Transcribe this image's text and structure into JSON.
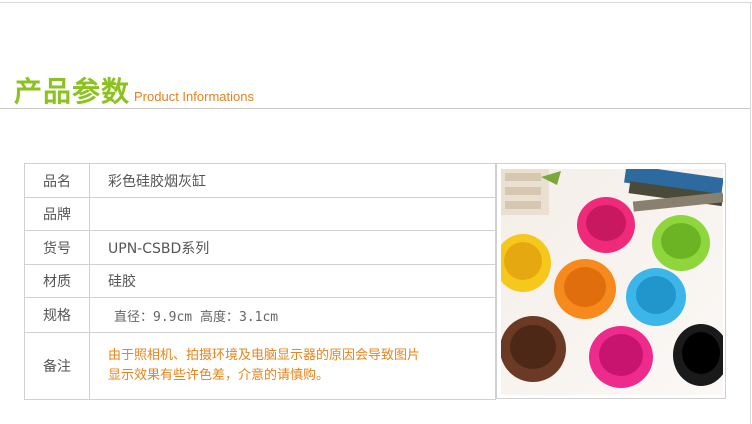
{
  "header": {
    "title_cn": "产品参数",
    "title_en": "Product Informations"
  },
  "specs": [
    {
      "label": "品名",
      "value": "彩色硅胶烟灰缸"
    },
    {
      "label": "品牌",
      "value": ""
    },
    {
      "label": "货号",
      "value": "UPN-CSBD系列"
    },
    {
      "label": "材质",
      "value": "硅胶"
    },
    {
      "label": "规格",
      "value": "直径：9.9cm 高度：3.1cm"
    },
    {
      "label": "备注",
      "value_line1": "由于照相机、拍摄环境及电脑显示器的原因会导致图片",
      "value_line2": "显示效果有些许色差，介意的请慎购。"
    }
  ],
  "colors": {
    "heading_green": "#8cc21f",
    "heading_orange": "#e8801a",
    "note_orange": "#e8841a",
    "ashtray_pink": "#f02a7a",
    "ashtray_green": "#8ed63c",
    "ashtray_yellow": "#f6c81c",
    "ashtray_orange": "#f78a1c",
    "ashtray_blue": "#3cb6e8",
    "ashtray_brown": "#6a3a24",
    "ashtray_magenta": "#ee2a8c",
    "ashtray_black": "#1a1a1a"
  }
}
